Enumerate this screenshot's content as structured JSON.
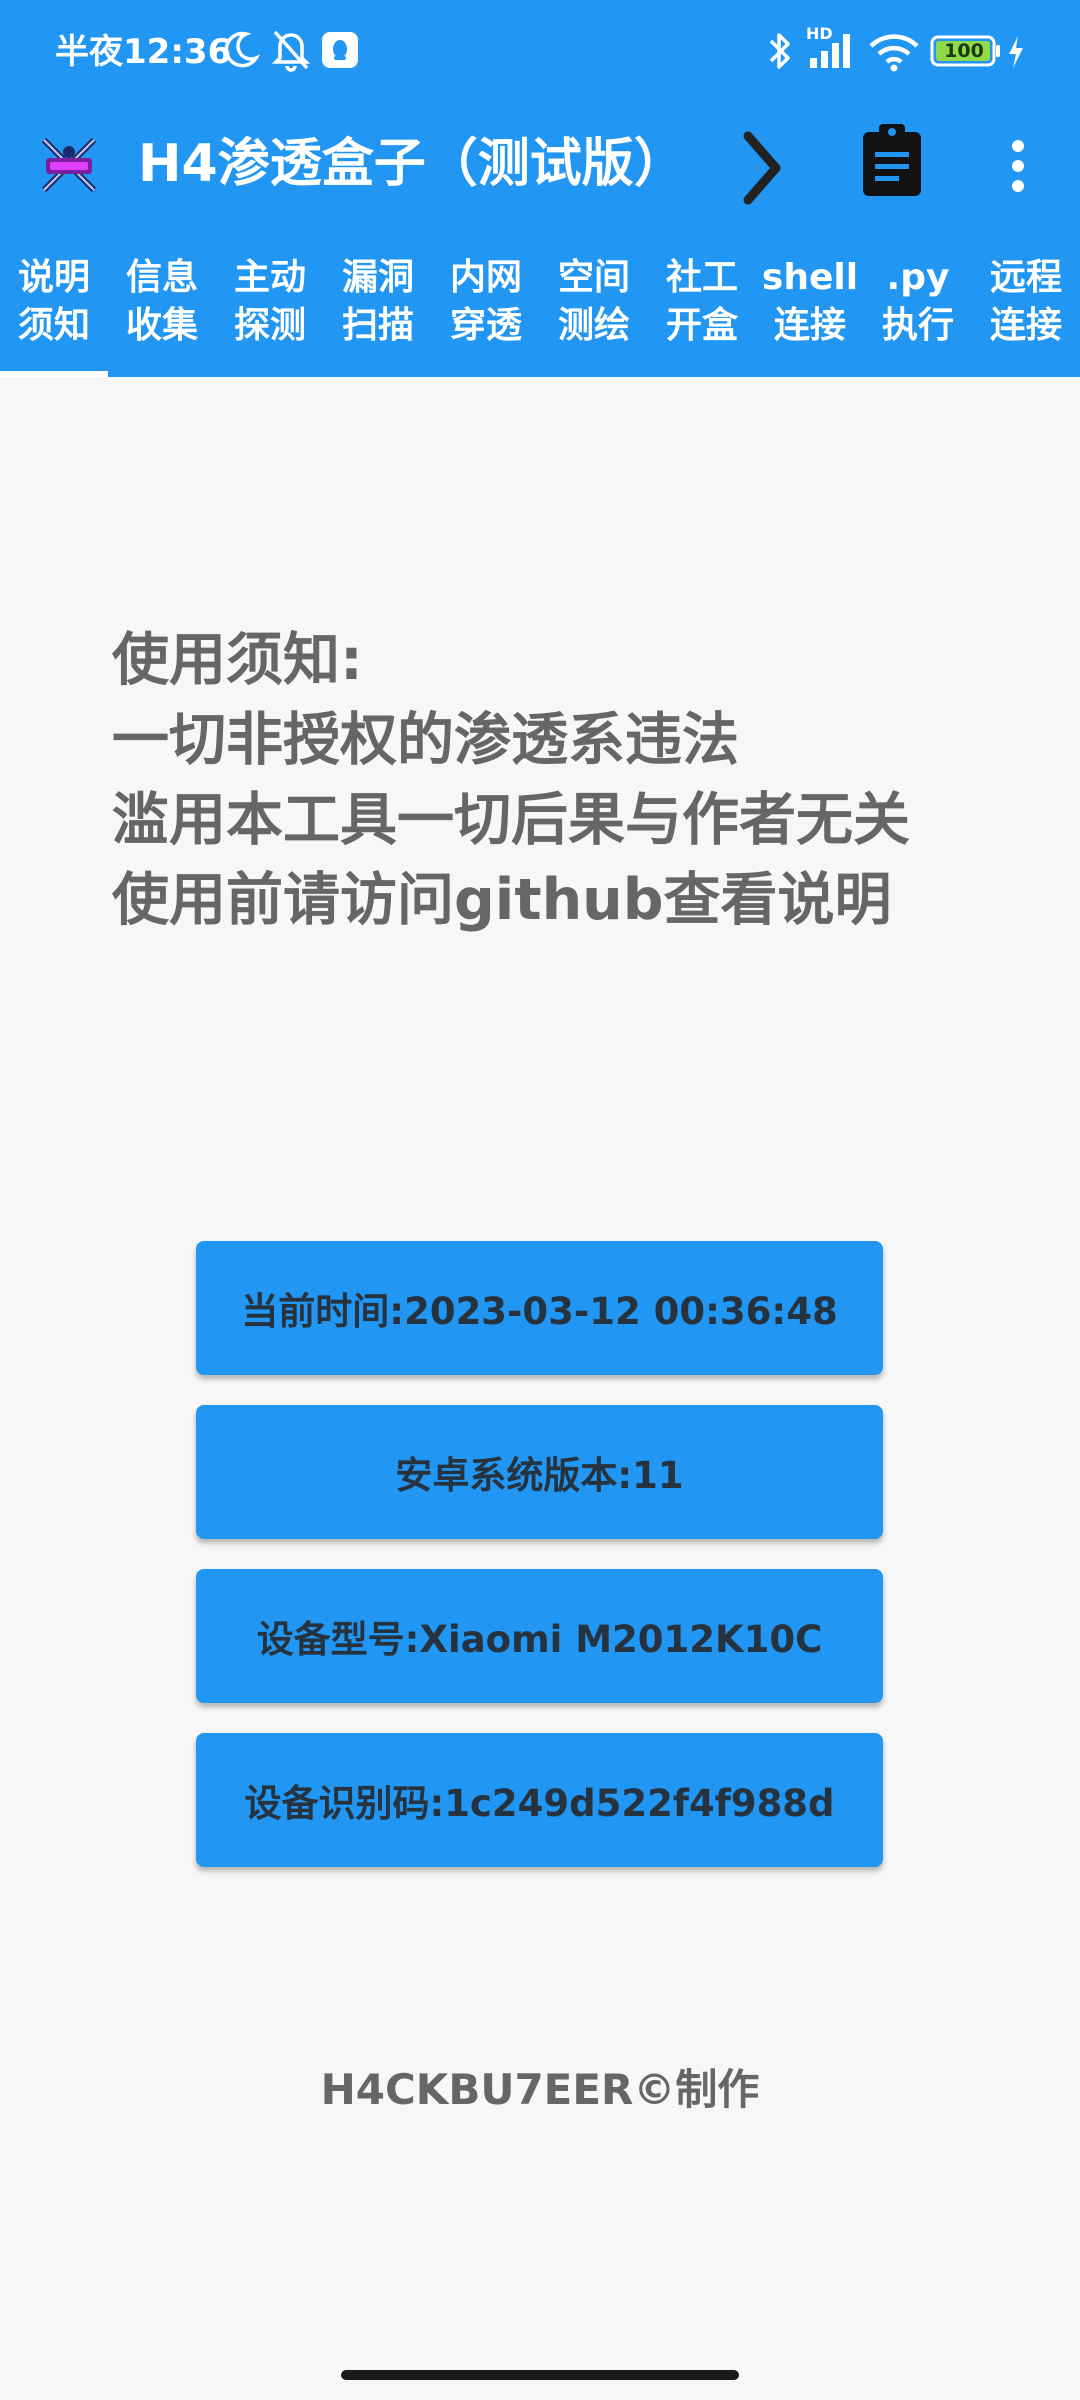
{
  "status_bar": {
    "time": "半夜12:36",
    "network_badge": "HD",
    "battery_level": "100",
    "icons": [
      "moon-icon",
      "bell-off-icon",
      "qq-notification-icon",
      "bluetooth-icon",
      "signal-icon",
      "wifi-icon",
      "battery-icon",
      "charging-icon"
    ]
  },
  "app_bar": {
    "title": "H4渗透盒子（测试版）",
    "icons": [
      "app-logo-icon",
      "chevron-right-icon",
      "clipboard-icon",
      "more-vert-icon"
    ]
  },
  "tabs": [
    {
      "label": "说明\n须知",
      "selected": true
    },
    {
      "label": "信息\n收集",
      "selected": false
    },
    {
      "label": "主动\n探测",
      "selected": false
    },
    {
      "label": "漏洞\n扫描",
      "selected": false
    },
    {
      "label": "内网\n穿透",
      "selected": false
    },
    {
      "label": "空间\n测绘",
      "selected": false
    },
    {
      "label": "社工\n开盒",
      "selected": false
    },
    {
      "label": "shell\n连接",
      "selected": false
    },
    {
      "label": ".py\n执行",
      "selected": false
    },
    {
      "label": "远程\n连接",
      "selected": false
    }
  ],
  "notice": {
    "lines": [
      "使用须知:",
      "一切非授权的渗透系违法",
      "滥用本工具一切后果与作者无关",
      "使用前请访问github查看说明"
    ]
  },
  "info_buttons": [
    {
      "label": "当前时间:2023-03-12 00:36:48"
    },
    {
      "label": "安卓系统版本:11"
    },
    {
      "label": "设备型号:Xiaomi M2012K10C"
    },
    {
      "label": "设备识别码:1c249d522f4f988d"
    }
  ],
  "footer": {
    "credit": "H4CKBU7EER©制作"
  },
  "colors": {
    "primary": "#2196f3",
    "background": "#f7f7f7",
    "notice_text": "#666666",
    "button_text": "#26323d"
  }
}
